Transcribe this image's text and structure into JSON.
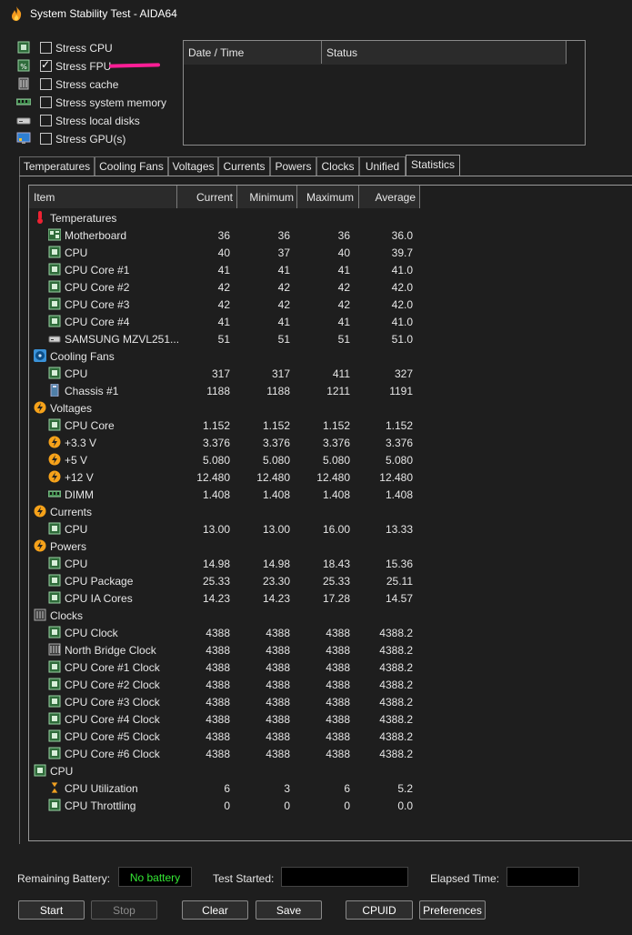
{
  "window": {
    "title": "System Stability Test - AIDA64"
  },
  "stress_options": [
    {
      "label": "Stress CPU",
      "checked": false,
      "icon": "cpu-chip-icon"
    },
    {
      "label": "Stress FPU",
      "checked": true,
      "icon": "fpu-chip-icon"
    },
    {
      "label": "Stress cache",
      "checked": false,
      "icon": "cache-icon"
    },
    {
      "label": "Stress system memory",
      "checked": false,
      "icon": "memory-icon"
    },
    {
      "label": "Stress local disks",
      "checked": false,
      "icon": "disk-icon"
    },
    {
      "label": "Stress GPU(s)",
      "checked": false,
      "icon": "gpu-monitor-icon"
    }
  ],
  "log": {
    "col_datetime": "Date / Time",
    "col_status": "Status"
  },
  "tabs": [
    "Temperatures",
    "Cooling Fans",
    "Voltages",
    "Currents",
    "Powers",
    "Clocks",
    "Unified",
    "Statistics"
  ],
  "active_tab": "Statistics",
  "stats": {
    "columns": {
      "item": "Item",
      "current": "Current",
      "minimum": "Minimum",
      "maximum": "Maximum",
      "average": "Average"
    },
    "rows": [
      {
        "type": "group",
        "name": "Temperatures",
        "icon": "thermometer-icon"
      },
      {
        "name": "Motherboard",
        "icon": "motherboard-icon",
        "current": "36",
        "minimum": "36",
        "maximum": "36",
        "average": "36.0"
      },
      {
        "name": "CPU",
        "icon": "chip-icon",
        "current": "40",
        "minimum": "37",
        "maximum": "40",
        "average": "39.7"
      },
      {
        "name": "CPU Core #1",
        "icon": "chip-icon",
        "current": "41",
        "minimum": "41",
        "maximum": "41",
        "average": "41.0"
      },
      {
        "name": "CPU Core #2",
        "icon": "chip-icon",
        "current": "42",
        "minimum": "42",
        "maximum": "42",
        "average": "42.0"
      },
      {
        "name": "CPU Core #3",
        "icon": "chip-icon",
        "current": "42",
        "minimum": "42",
        "maximum": "42",
        "average": "42.0"
      },
      {
        "name": "CPU Core #4",
        "icon": "chip-icon",
        "current": "41",
        "minimum": "41",
        "maximum": "41",
        "average": "41.0"
      },
      {
        "name": "SAMSUNG MZVL251...",
        "icon": "disk-icon",
        "current": "51",
        "minimum": "51",
        "maximum": "51",
        "average": "51.0"
      },
      {
        "type": "group",
        "name": "Cooling Fans",
        "icon": "fan-icon"
      },
      {
        "name": "CPU",
        "icon": "chip-icon",
        "current": "317",
        "minimum": "317",
        "maximum": "411",
        "average": "327"
      },
      {
        "name": "Chassis #1",
        "icon": "chassis-icon",
        "current": "1188",
        "minimum": "1188",
        "maximum": "1211",
        "average": "1191"
      },
      {
        "type": "group",
        "name": "Voltages",
        "icon": "voltage-icon"
      },
      {
        "name": "CPU Core",
        "icon": "chip-icon",
        "current": "1.152",
        "minimum": "1.152",
        "maximum": "1.152",
        "average": "1.152"
      },
      {
        "name": "+3.3 V",
        "icon": "voltage-icon",
        "current": "3.376",
        "minimum": "3.376",
        "maximum": "3.376",
        "average": "3.376"
      },
      {
        "name": "+5 V",
        "icon": "voltage-icon",
        "current": "5.080",
        "minimum": "5.080",
        "maximum": "5.080",
        "average": "5.080"
      },
      {
        "name": "+12 V",
        "icon": "voltage-icon",
        "current": "12.480",
        "minimum": "12.480",
        "maximum": "12.480",
        "average": "12.480"
      },
      {
        "name": "DIMM",
        "icon": "memory-icon",
        "current": "1.408",
        "minimum": "1.408",
        "maximum": "1.408",
        "average": "1.408"
      },
      {
        "type": "group",
        "name": "Currents",
        "icon": "voltage-icon"
      },
      {
        "name": "CPU",
        "icon": "chip-icon",
        "current": "13.00",
        "minimum": "13.00",
        "maximum": "16.00",
        "average": "13.33"
      },
      {
        "type": "group",
        "name": "Powers",
        "icon": "voltage-icon"
      },
      {
        "name": "CPU",
        "icon": "chip-icon",
        "current": "14.98",
        "minimum": "14.98",
        "maximum": "18.43",
        "average": "15.36"
      },
      {
        "name": "CPU Package",
        "icon": "chip-icon",
        "current": "25.33",
        "minimum": "23.30",
        "maximum": "25.33",
        "average": "25.11"
      },
      {
        "name": "CPU IA Cores",
        "icon": "chip-icon",
        "current": "14.23",
        "minimum": "14.23",
        "maximum": "17.28",
        "average": "14.57"
      },
      {
        "type": "group",
        "name": "Clocks",
        "icon": "clock-chip-icon"
      },
      {
        "name": "CPU Clock",
        "icon": "chip-icon",
        "current": "4388",
        "minimum": "4388",
        "maximum": "4388",
        "average": "4388.2"
      },
      {
        "name": "North Bridge Clock",
        "icon": "northbridge-icon",
        "current": "4388",
        "minimum": "4388",
        "maximum": "4388",
        "average": "4388.2"
      },
      {
        "name": "CPU Core #1 Clock",
        "icon": "chip-icon",
        "current": "4388",
        "minimum": "4388",
        "maximum": "4388",
        "average": "4388.2"
      },
      {
        "name": "CPU Core #2 Clock",
        "icon": "chip-icon",
        "current": "4388",
        "minimum": "4388",
        "maximum": "4388",
        "average": "4388.2"
      },
      {
        "name": "CPU Core #3 Clock",
        "icon": "chip-icon",
        "current": "4388",
        "minimum": "4388",
        "maximum": "4388",
        "average": "4388.2"
      },
      {
        "name": "CPU Core #4 Clock",
        "icon": "chip-icon",
        "current": "4388",
        "minimum": "4388",
        "maximum": "4388",
        "average": "4388.2"
      },
      {
        "name": "CPU Core #5 Clock",
        "icon": "chip-icon",
        "current": "4388",
        "minimum": "4388",
        "maximum": "4388",
        "average": "4388.2"
      },
      {
        "name": "CPU Core #6 Clock",
        "icon": "chip-icon",
        "current": "4388",
        "minimum": "4388",
        "maximum": "4388",
        "average": "4388.2"
      },
      {
        "type": "group",
        "name": "CPU",
        "icon": "chip-icon"
      },
      {
        "name": "CPU Utilization",
        "icon": "hourglass-icon",
        "current": "6",
        "minimum": "3",
        "maximum": "6",
        "average": "5.2"
      },
      {
        "name": "CPU Throttling",
        "icon": "chip-icon",
        "current": "0",
        "minimum": "0",
        "maximum": "0",
        "average": "0.0"
      }
    ]
  },
  "footer": {
    "battery_label": "Remaining Battery:",
    "battery_value": "No battery",
    "test_started_label": "Test Started:",
    "elapsed_label": "Elapsed Time:"
  },
  "buttons": {
    "start": "Start",
    "stop": "Stop",
    "clear": "Clear",
    "save": "Save",
    "cpuid": "CPUID",
    "preferences": "Preferences"
  },
  "colors": {
    "background": "#1e1e1e",
    "header": "#2b2b2b",
    "battery_text": "#34e834",
    "annotation": "#ff1e96"
  }
}
